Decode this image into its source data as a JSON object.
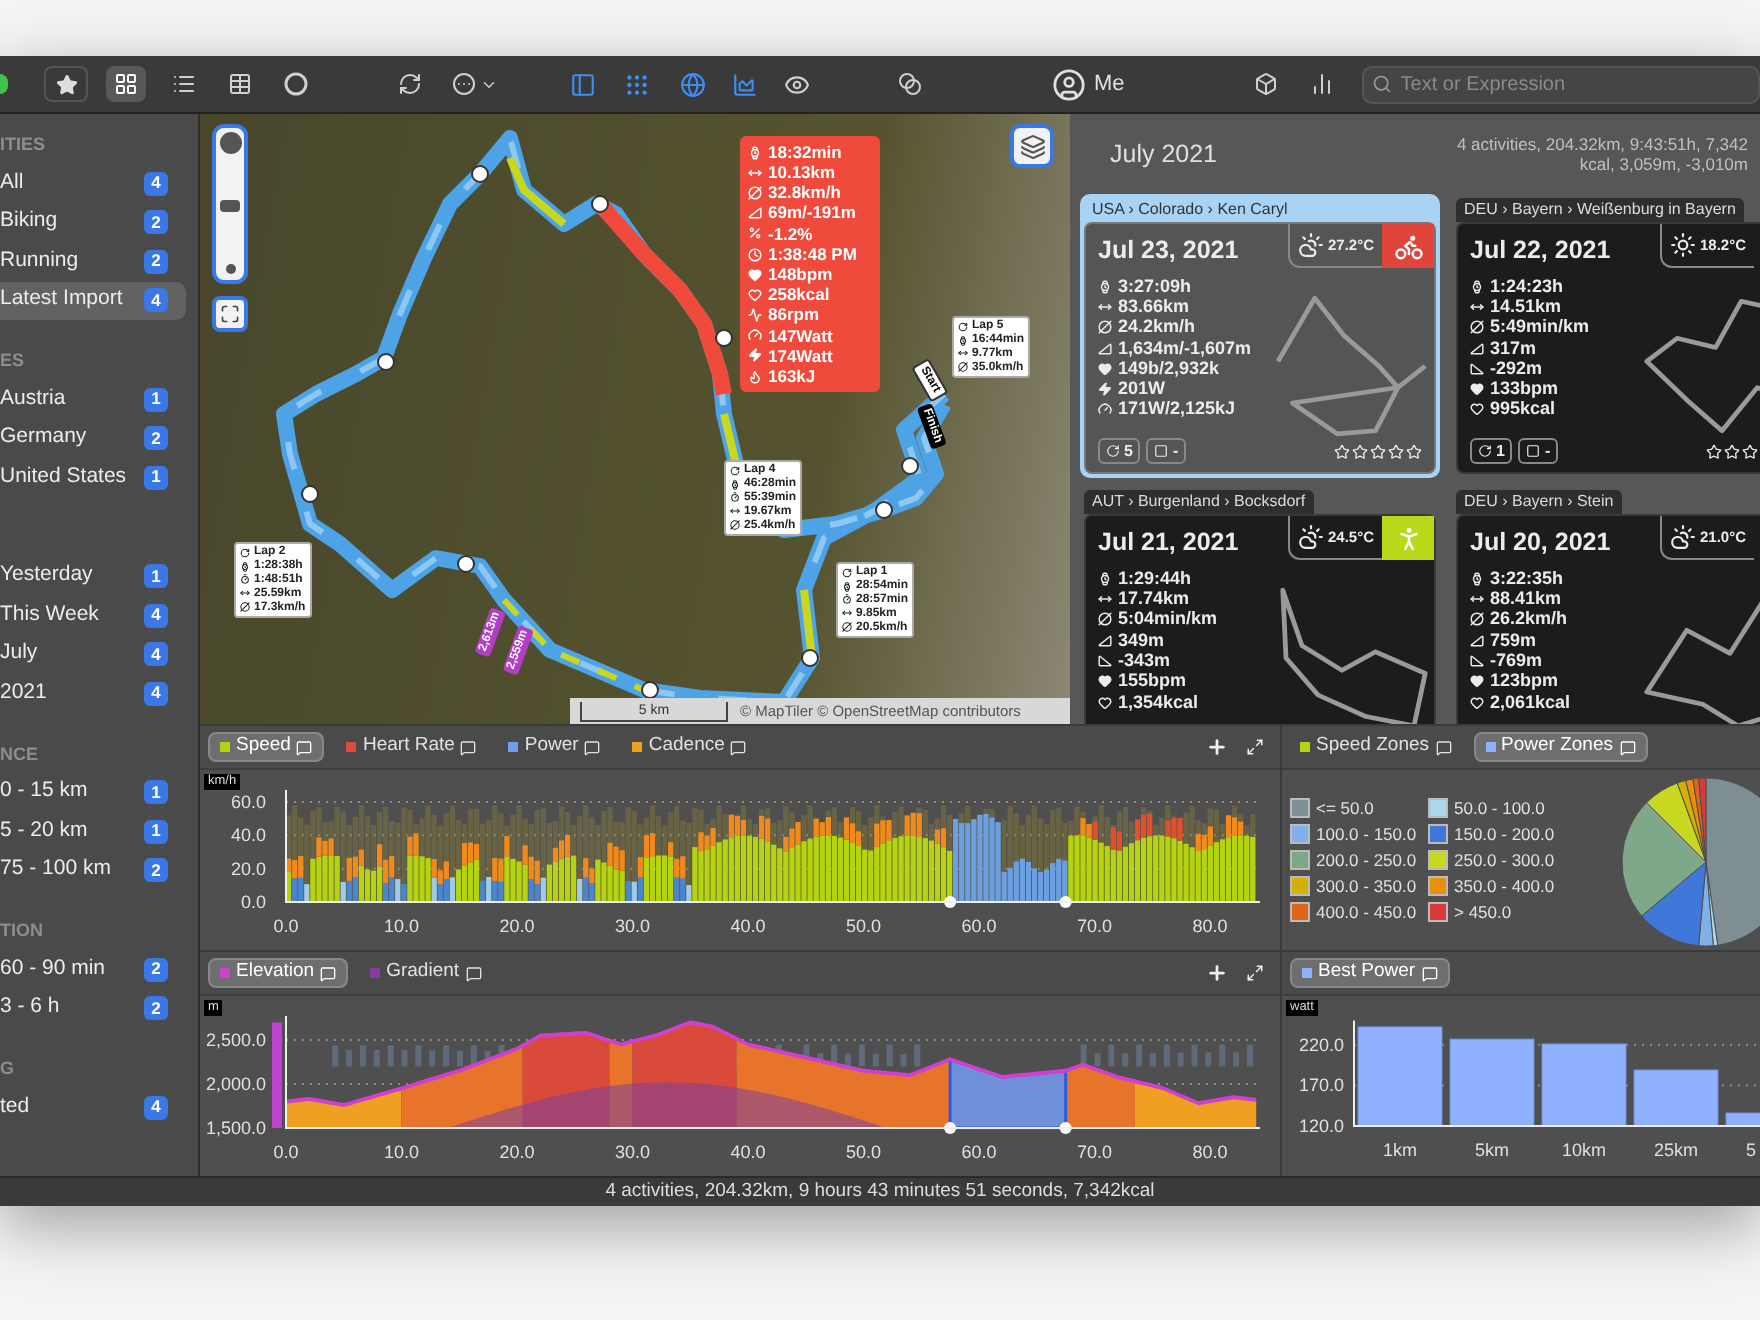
{
  "toolbar": {
    "layout_buttons": [
      {
        "kind": "grid",
        "selected": true
      },
      {
        "kind": "list",
        "selected": false
      },
      {
        "kind": "table",
        "selected": false
      }
    ],
    "view_toggles": [
      {
        "kind": "sidebar",
        "on": true
      },
      {
        "kind": "grid",
        "on": true
      },
      {
        "kind": "map",
        "on": true
      },
      {
        "kind": "chart",
        "on": true
      },
      {
        "kind": "eye",
        "on": false
      }
    ],
    "user": "Me",
    "search": {
      "placeholder": "Text or Expression"
    }
  },
  "sidebar": {
    "sections": [
      {
        "title": "ITIES",
        "items": [
          {
            "label": "All",
            "count": "4",
            "selected": false
          },
          {
            "label": "Biking",
            "count": "2",
            "selected": false
          },
          {
            "label": "Running",
            "count": "2",
            "selected": false
          },
          {
            "label": "Latest Import",
            "count": "4",
            "selected": true
          }
        ]
      },
      {
        "title": "ES",
        "items": [
          {
            "label": "Austria",
            "count": "1",
            "selected": false
          },
          {
            "label": "Germany",
            "count": "2",
            "selected": false
          },
          {
            "label": "United States",
            "count": "1",
            "selected": false
          }
        ]
      },
      {
        "items": [
          {
            "label": "Yesterday",
            "count": "1",
            "selected": false
          },
          {
            "label": "This Week",
            "count": "4",
            "selected": false
          },
          {
            "label": "July",
            "count": "4",
            "selected": false
          },
          {
            "label": "2021",
            "count": "4",
            "selected": false
          }
        ]
      },
      {
        "title": "NCE",
        "items": [
          {
            "label": "0 - 15 km",
            "count": "1",
            "selected": false
          },
          {
            "label": "5 - 20 km",
            "count": "1",
            "selected": false
          },
          {
            "label": "75 - 100 km",
            "count": "2",
            "selected": false
          }
        ]
      },
      {
        "title": "TION",
        "items": [
          {
            "label": "60 - 90 min",
            "count": "2",
            "selected": false
          },
          {
            "label": "3 - 6 h",
            "count": "2",
            "selected": false
          }
        ]
      },
      {
        "title": "G",
        "items": [
          {
            "label": "ted",
            "count": "4",
            "selected": false
          }
        ]
      }
    ]
  },
  "map": {
    "zoom": {
      "level": 0.5
    },
    "popup": [
      {
        "kind": "duration",
        "value": "18:32min"
      },
      {
        "kind": "distance",
        "value": "10.13km"
      },
      {
        "kind": "speed",
        "value": "32.8km/h"
      },
      {
        "kind": "elevation",
        "value": "69m/-191m"
      },
      {
        "kind": "gradient",
        "value": "-1.2%"
      },
      {
        "kind": "time",
        "value": "1:38:48 PM"
      },
      {
        "kind": "heart",
        "value": "148bpm"
      },
      {
        "kind": "kcal",
        "value": "258kcal"
      },
      {
        "kind": "cadence",
        "value": "86rpm"
      },
      {
        "kind": "avg_power",
        "value": "147Watt"
      },
      {
        "kind": "power",
        "value": "174Watt"
      },
      {
        "kind": "energy",
        "value": "163kJ"
      }
    ],
    "laps": [
      {
        "lines": [
          {
            "kind": "lap",
            "text": "Lap 5"
          },
          {
            "kind": "duration",
            "text": "16:44min"
          },
          {
            "kind": "distance",
            "text": "9.77km"
          },
          {
            "kind": "speed",
            "text": "35.0km/h"
          }
        ]
      },
      {
        "lines": [
          {
            "kind": "lap",
            "text": "Lap 4"
          },
          {
            "kind": "duration",
            "text": "46:28min"
          },
          {
            "kind": "elapsed",
            "text": "55:39min"
          },
          {
            "kind": "distance",
            "text": "19.67km"
          },
          {
            "kind": "speed",
            "text": "25.4km/h"
          }
        ]
      },
      {
        "lines": [
          {
            "kind": "lap",
            "text": "Lap 1"
          },
          {
            "kind": "duration",
            "text": "28:54min"
          },
          {
            "kind": "elapsed",
            "text": "28:57min"
          },
          {
            "kind": "distance",
            "text": "9.85km"
          },
          {
            "kind": "speed",
            "text": "20.5km/h"
          }
        ]
      },
      {
        "lines": [
          {
            "kind": "lap",
            "text": "Lap 2"
          },
          {
            "kind": "duration",
            "text": "1:28:38h"
          },
          {
            "kind": "elapsed",
            "text": "1:48:51h"
          },
          {
            "kind": "distance",
            "text": "25.59km"
          },
          {
            "kind": "speed",
            "text": "17.3km/h"
          }
        ]
      }
    ],
    "flags": [
      {
        "kind": "start",
        "label": "Start"
      },
      {
        "kind": "finish",
        "label": "Finish"
      }
    ],
    "elevation_tags": [
      "2,613m",
      "2,559m"
    ],
    "scale": "5 km",
    "attribution": "© MapTiler © OpenStreetMap contributors"
  },
  "activities": {
    "title": "July 2021",
    "summary": "4 activities, 204.32km, 9:43:51h, 7,342 kcal, 3,059m, -3,010m",
    "cards": [
      {
        "location": "USA › Colorado › Ken Caryl",
        "date": "Jul 23, 2021",
        "selected": true,
        "weather": {
          "kind": "cloud_sun",
          "temp": "27.2°C"
        },
        "sport_badge": {
          "kind": "bike"
        },
        "stats": [
          {
            "kind": "duration",
            "value": "3:27:09h"
          },
          {
            "kind": "distance",
            "value": "83.66km"
          },
          {
            "kind": "speed",
            "value": "24.2km/h"
          },
          {
            "kind": "elevation",
            "value": "1,634m/-1,607m"
          },
          {
            "kind": "heart",
            "value": "149b/2,932k"
          },
          {
            "kind": "power",
            "value": "201W"
          },
          {
            "kind": "avg_power",
            "value": "171W/2,125kJ"
          }
        ],
        "footer": {
          "laps": "5",
          "tag": "-"
        },
        "stars": 0
      },
      {
        "location": "DEU › Bayern › Weißenburg in Bayern",
        "date": "Jul 22, 2021",
        "selected": false,
        "weather": {
          "kind": "sun",
          "temp": "18.2°C"
        },
        "stats": [
          {
            "kind": "duration",
            "value": "1:24:23h"
          },
          {
            "kind": "distance",
            "value": "14.51km"
          },
          {
            "kind": "speed",
            "value": "5:49min/km"
          },
          {
            "kind": "elevation",
            "value": "317m"
          },
          {
            "kind": "descent",
            "value": "-292m"
          },
          {
            "kind": "heart",
            "value": "133bpm"
          },
          {
            "kind": "kcal",
            "value": "995kcal"
          }
        ],
        "footer": {
          "laps": "1",
          "tag": "-"
        },
        "stars": 0
      },
      {
        "location": "AUT › Burgenland › Bocksdorf",
        "date": "Jul 21, 2021",
        "selected": false,
        "weather": {
          "kind": "cloud_sun",
          "temp": "24.5°C"
        },
        "sport_badge": {
          "kind": "run"
        },
        "stats": [
          {
            "kind": "duration",
            "value": "1:29:44h"
          },
          {
            "kind": "distance",
            "value": "17.74km"
          },
          {
            "kind": "speed",
            "value": "5:04min/km"
          },
          {
            "kind": "elevation",
            "value": "349m"
          },
          {
            "kind": "descent",
            "value": "-343m"
          },
          {
            "kind": "heart",
            "value": "155bpm"
          },
          {
            "kind": "kcal",
            "value": "1,354kcal"
          }
        ]
      },
      {
        "location": "DEU › Bayern › Stein",
        "date": "Jul 20, 2021",
        "selected": false,
        "weather": {
          "kind": "cloud_sun",
          "temp": "21.0°C"
        },
        "stats": [
          {
            "kind": "duration",
            "value": "3:22:35h"
          },
          {
            "kind": "distance",
            "value": "88.41km"
          },
          {
            "kind": "speed",
            "value": "26.2km/h"
          },
          {
            "kind": "elevation",
            "value": "759m"
          },
          {
            "kind": "descent",
            "value": "-769m"
          },
          {
            "kind": "heart",
            "value": "123bpm"
          },
          {
            "kind": "kcal",
            "value": "2,061kcal"
          }
        ]
      }
    ]
  },
  "charts": [
    {
      "kind": "bars",
      "tabs": [
        {
          "label": "Speed",
          "color": "#b5d40f",
          "selected": true
        },
        {
          "label": "Heart Rate",
          "color": "#e04a3a",
          "selected": false
        },
        {
          "label": "Power",
          "color": "#6f9fe8",
          "selected": false
        },
        {
          "label": "Cadence",
          "color": "#f0a020",
          "selected": false
        }
      ],
      "unit": "km/h",
      "yticks": [
        "60.0",
        "40.0",
        "20.0",
        "0.0"
      ],
      "xticks": [
        "0.0",
        "10.0",
        "20.0",
        "30.0",
        "40.0",
        "50.0",
        "60.0",
        "70.0",
        "80.0"
      ]
    },
    {
      "kind": "elevation",
      "tabs": [
        {
          "label": "Elevation",
          "color": "#d040d0",
          "selected": true
        },
        {
          "label": "Gradient",
          "color": "#8a3aa0",
          "selected": false
        }
      ],
      "unit": "m",
      "yticks": [
        "2,500.0",
        "2,000.0",
        "1,500.0"
      ],
      "xticks": [
        "0.0",
        "10.0",
        "20.0",
        "30.0",
        "40.0",
        "50.0",
        "60.0",
        "70.0",
        "80.0"
      ]
    }
  ],
  "zones": {
    "tabs": [
      {
        "label": "Speed Zones",
        "color": "#b5d40f",
        "selected": false
      },
      {
        "label": "Power Zones",
        "color": "#8fb0ff",
        "selected": true
      }
    ],
    "legend": [
      {
        "label": "<= 50.0",
        "color": "#7f8e92"
      },
      {
        "label": "50.0 - 100.0",
        "color": "#a8d8ea"
      },
      {
        "label": "100.0 - 150.0",
        "color": "#7fb0e8"
      },
      {
        "label": "150.0 - 200.0",
        "color": "#3f78d8"
      },
      {
        "label": "200.0 - 250.0",
        "color": "#7fa888"
      },
      {
        "label": "250.0 - 300.0",
        "color": "#c8d820"
      },
      {
        "label": "300.0 - 350.0",
        "color": "#d4b000"
      },
      {
        "label": "350.0 - 400.0",
        "color": "#e8900a"
      },
      {
        "label": "400.0 - 450.0",
        "color": "#e0641c"
      },
      {
        "label": "> 450.0",
        "color": "#d83a3a"
      }
    ]
  },
  "best_power": {
    "tab": {
      "selected": true
    },
    "unit": "watt",
    "chart_data": {
      "type": "bar",
      "categories": [
        "1km",
        "5km",
        "10km",
        "25km",
        "5"
      ],
      "series": [
        {
          "name": "Best Power",
          "color": "#8fb0ff",
          "values": [
            242,
            227,
            221,
            189,
            136
          ]
        }
      ],
      "ylim": [
        120,
        250
      ],
      "yticks": [
        {
          "value": 220,
          "label": "220.0"
        },
        {
          "value": 170,
          "label": "170.0"
        },
        {
          "value": 120,
          "label": "120.0"
        }
      ]
    }
  },
  "status_bar": "4 activities, 204.32km, 9 hours 43 minutes 51 seconds, 7,342kcal"
}
